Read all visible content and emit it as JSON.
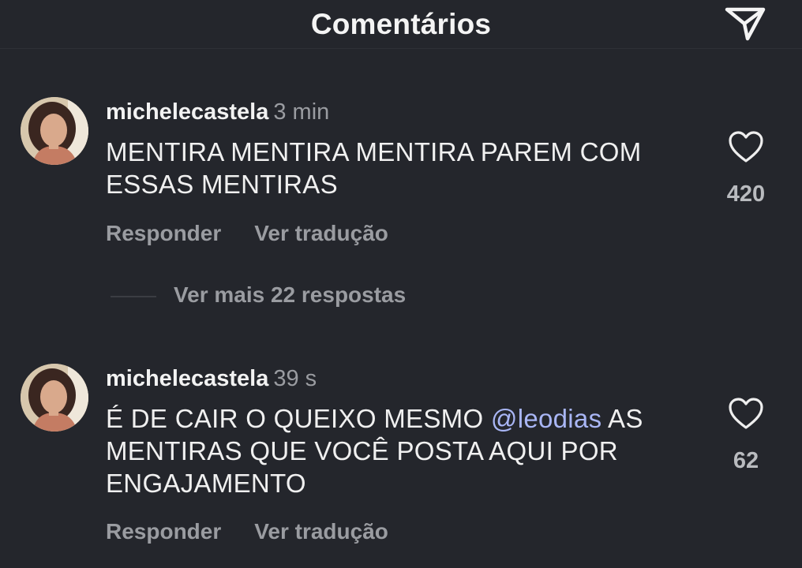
{
  "header": {
    "title": "Comentários",
    "send_icon": "send-icon"
  },
  "comments": [
    {
      "username": "michelecastela",
      "time": "3 min",
      "text": "MENTIRA MENTIRA MENTIRA PAREM COM ESSAS MENTIRAS",
      "likes": "420",
      "reply_label": "Responder",
      "translate_label": "Ver tradução"
    },
    {
      "username": "michelecastela",
      "time": "39 s",
      "text_before": "É DE CAIR O QUEIXO MESMO ",
      "mention": "@leodias",
      "text_after": " AS MENTIRAS QUE VOCÊ POSTA AQUI POR ENGAJAMENTO",
      "likes": "62",
      "reply_label": "Responder",
      "translate_label": "Ver tradução"
    }
  ],
  "more_replies": {
    "label": "Ver mais 22 respostas"
  },
  "colors": {
    "background": "#24262c",
    "muted": "#9a9ca1",
    "mention": "#a9b6f5"
  }
}
